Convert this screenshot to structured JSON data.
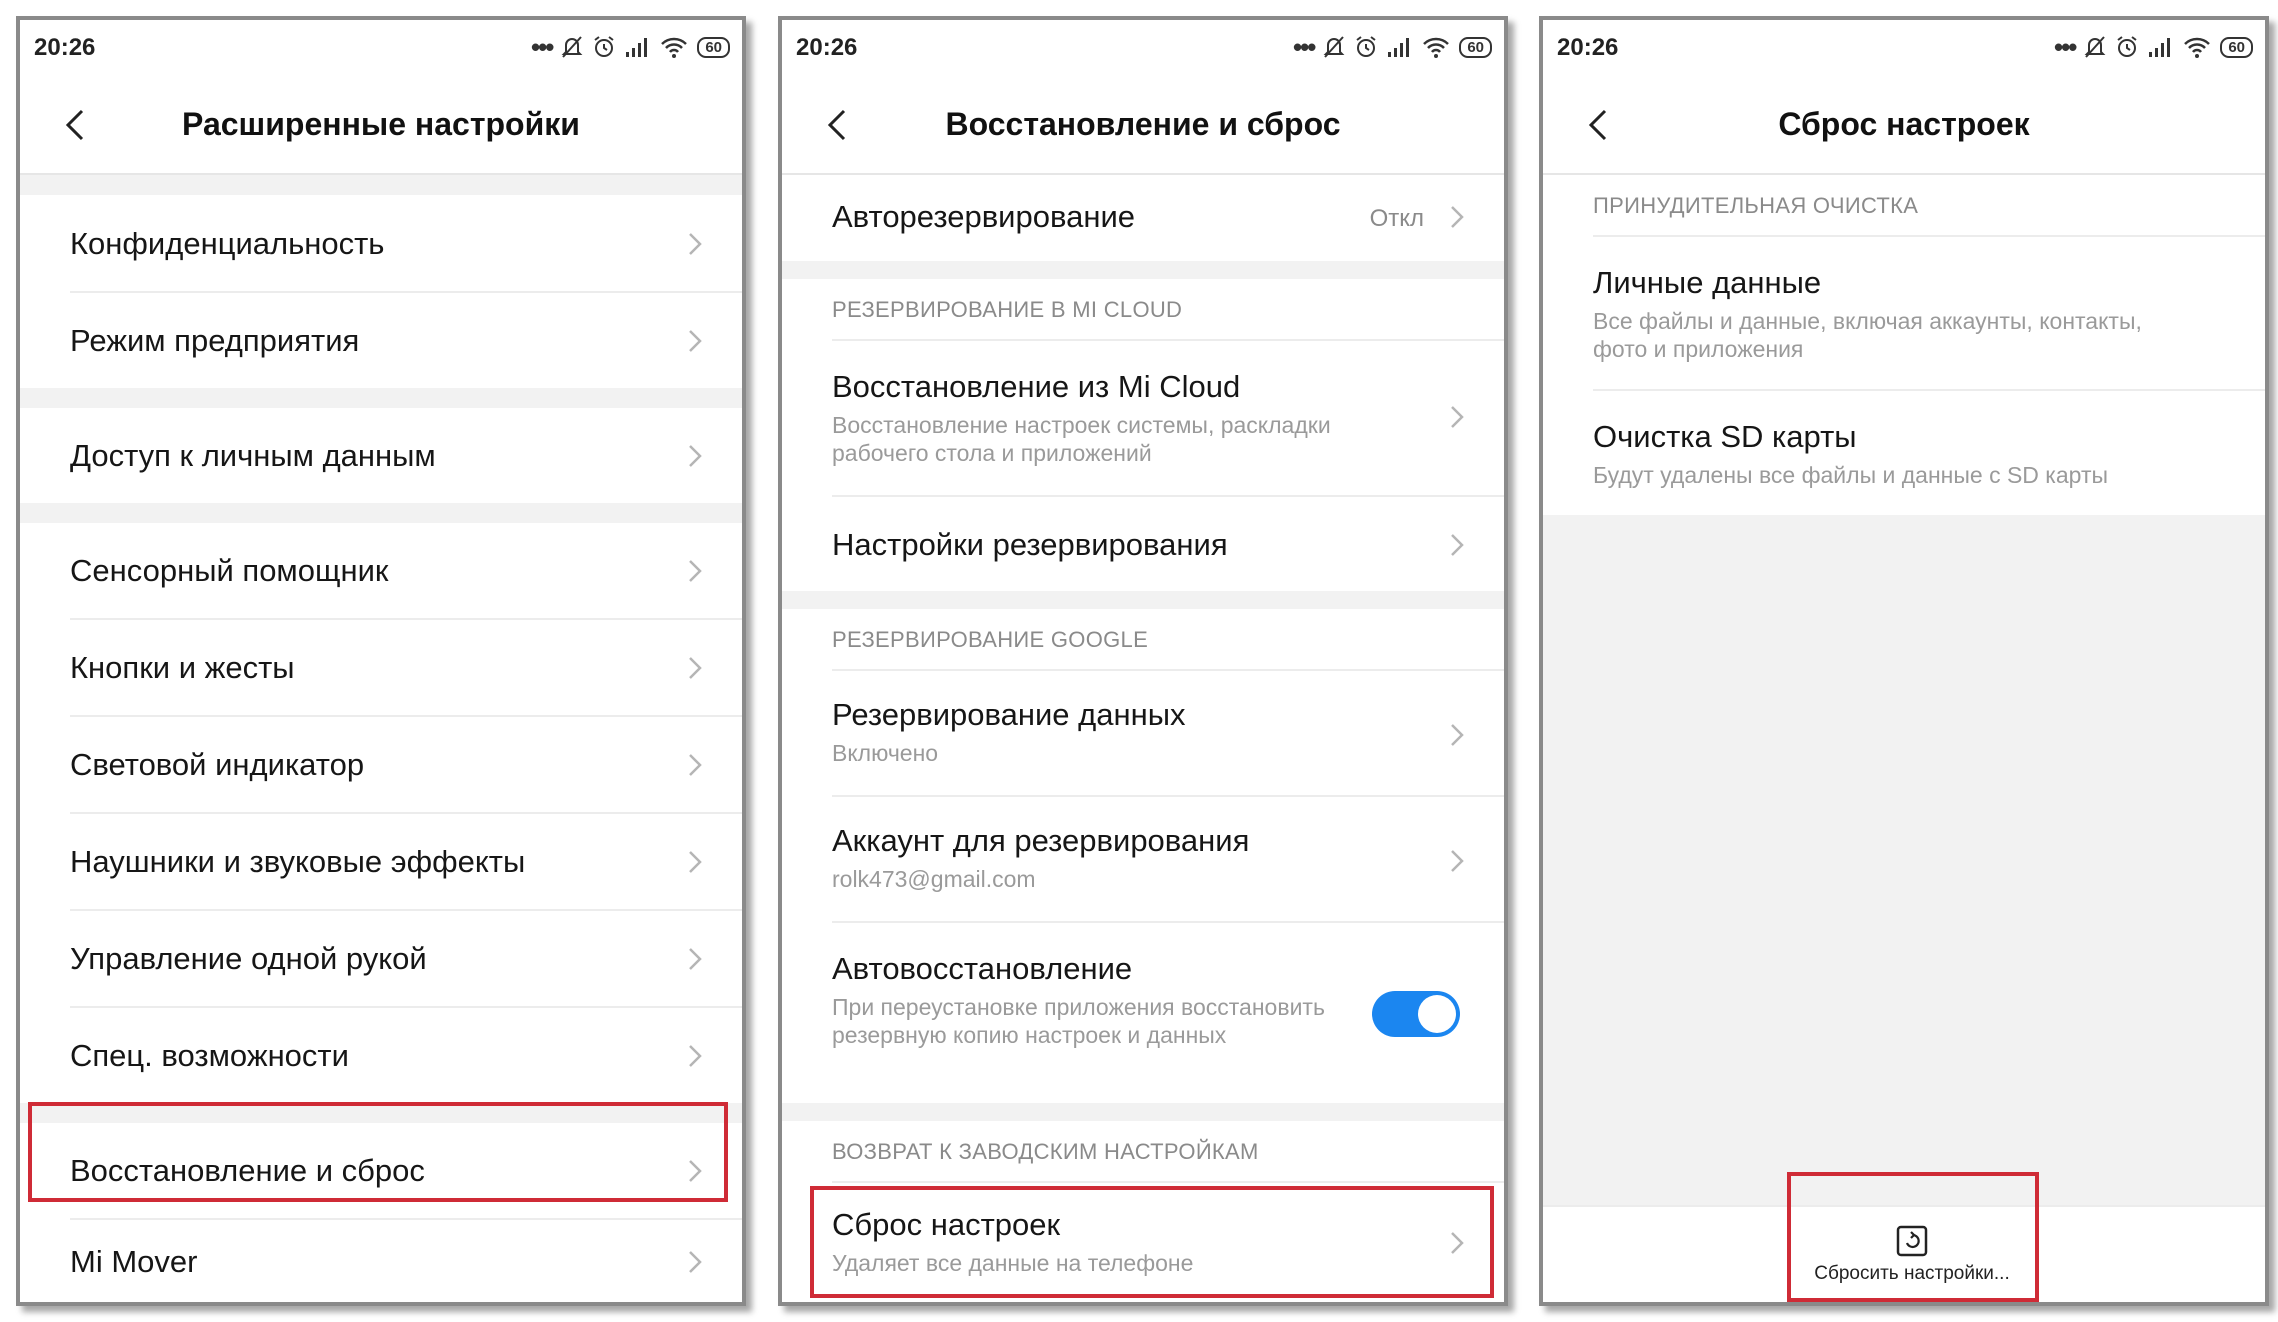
{
  "status": {
    "time": "20:26",
    "dots": "•••",
    "battery": "60"
  },
  "screen1": {
    "title": "Расширенные настройки",
    "items": [
      "Конфиденциальность",
      "Режим предприятия",
      "Доступ к личным данным",
      "Сенсорный помощник",
      "Кнопки и жесты",
      "Световой индикатор",
      "Наушники и звуковые эффекты",
      "Управление одной рукой",
      "Спец. возможности",
      "Восстановление и сброс",
      "Mi Mover"
    ]
  },
  "screen2": {
    "title": "Восстановление и сброс",
    "autobackup": {
      "label": "Авторезервирование",
      "value": "Откл"
    },
    "sec_mi": "РЕЗЕРВИРОВАНИЕ В MI CLOUD",
    "restore_mi": {
      "label": "Восстановление из Mi Cloud",
      "sub": "Восстановление настроек системы, раскладки рабочего стола и приложений"
    },
    "backup_settings": "Настройки резервирования",
    "sec_google": "РЕЗЕРВИРОВАНИЕ GOOGLE",
    "data_backup": {
      "label": "Резервирование данных",
      "sub": "Включено"
    },
    "account": {
      "label": "Аккаунт для резервирования",
      "sub": "rolk473@gmail.com"
    },
    "autorestore": {
      "label": "Автовосстановление",
      "sub": "При переустановке приложения восстановить резервную копию настроек и данных",
      "on": true
    },
    "sec_factory": "ВОЗВРАТ К ЗАВОДСКИМ НАСТРОЙКАМ",
    "factory": {
      "label": "Сброс настроек",
      "sub": "Удаляет все данные на телефоне"
    }
  },
  "screen3": {
    "title": "Сброс настроек",
    "sec": "ПРИНУДИТЕЛЬНАЯ ОЧИСТКА",
    "personal": {
      "label": "Личные данные",
      "sub": "Все файлы и данные, включая аккаунты, контакты, фото и приложения"
    },
    "sd": {
      "label": "Очистка SD карты",
      "sub": "Будут удалены все файлы и данные с SD карты"
    },
    "reset_button": "Сбросить настройки..."
  },
  "colors": {
    "highlight": "#cf2b36",
    "toggle": "#1b86f0"
  },
  "icons": [
    "back-arrow-icon",
    "chevron-right-icon",
    "bell-off-icon",
    "alarm-icon",
    "signal-icon",
    "wifi-icon",
    "battery-icon",
    "reset-icon"
  ]
}
